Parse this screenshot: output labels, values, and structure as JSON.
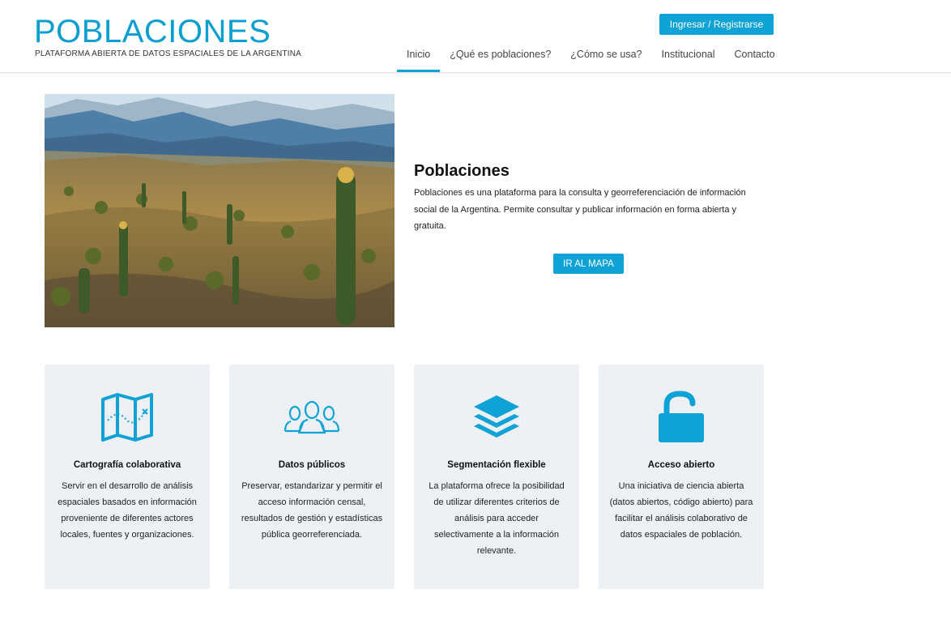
{
  "header": {
    "logo_title": "POBLACIONES",
    "logo_subtitle": "PLATAFORMA ABIERTA DE DATOS ESPACIALES DE LA ARGENTINA",
    "login_label": "Ingresar / Registrarse",
    "nav": [
      {
        "label": "Inicio",
        "active": true
      },
      {
        "label": "¿Qué es poblaciones?",
        "active": false
      },
      {
        "label": "¿Cómo se usa?",
        "active": false
      },
      {
        "label": "Institucional",
        "active": false
      },
      {
        "label": "Contacto",
        "active": false
      }
    ]
  },
  "hero": {
    "title": "Poblaciones",
    "text": "Poblaciones es una plataforma  para la consulta y georreferenciación de información social de la Argentina. Permite consultar y publicar información en forma abierta y gratuita.",
    "button_label": "IR AL MAPA"
  },
  "cards": [
    {
      "icon": "map-icon",
      "title": "Cartografía colaborativa",
      "text": "Servir en el desarrollo de análisis espaciales basados en información proveniente de diferentes actores locales, fuentes y organizaciones."
    },
    {
      "icon": "people-icon",
      "title": "Datos públicos",
      "text": "Preservar, estandarizar y permitir el acceso información censal, resultados de gestión y estadísticas pública georreferenciada."
    },
    {
      "icon": "layers-icon",
      "title": "Segmentación flexible",
      "text": "La plataforma ofrece la posibilidad de utilizar diferentes criterios de análisis para acceder selectivamente a la información relevante."
    },
    {
      "icon": "unlock-icon",
      "title": "Acceso abierto",
      "text": "Una iniciativa de ciencia abierta (datos abiertos, código abierto) para facilitar el análisis colaborativo de datos espaciales de población."
    }
  ],
  "colors": {
    "accent": "#0fa2d6",
    "card_bg": "#edf1f5"
  }
}
